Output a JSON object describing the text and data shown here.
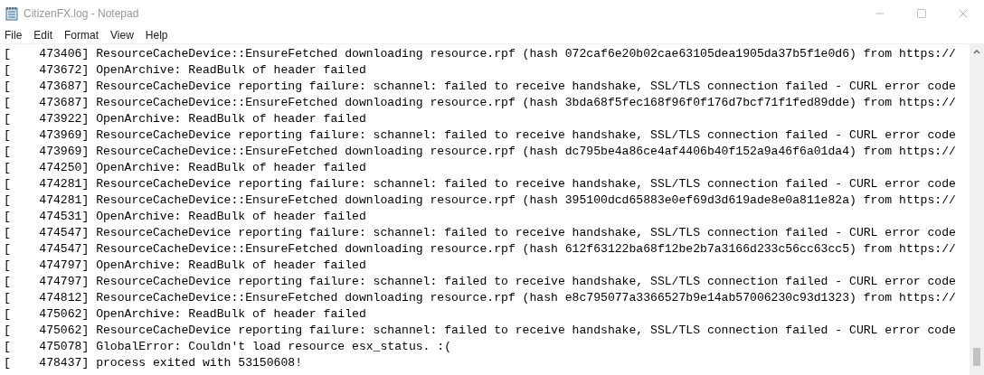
{
  "window": {
    "title": "CitizenFX.log - Notepad"
  },
  "menu": [
    "File",
    "Edit",
    "Format",
    "View",
    "Help"
  ],
  "lines": [
    "[    473406] ResourceCacheDevice::EnsureFetched downloading resource.rpf (hash 072caf6e20b02cae63105dea1905da37b5f1e0d6) from https://",
    "[    473672] OpenArchive: ReadBulk of header failed",
    "[    473687] ResourceCacheDevice reporting failure: schannel: failed to receive handshake, SSL/TLS connection failed - CURL error code",
    "[    473687] ResourceCacheDevice::EnsureFetched downloading resource.rpf (hash 3bda68f5fec168f96f0f176d7bcf71f1fed89dde) from https://",
    "[    473922] OpenArchive: ReadBulk of header failed",
    "[    473969] ResourceCacheDevice reporting failure: schannel: failed to receive handshake, SSL/TLS connection failed - CURL error code",
    "[    473969] ResourceCacheDevice::EnsureFetched downloading resource.rpf (hash dc795be4a86ce4af4406b40f152a9a46f6a01da4) from https://",
    "[    474250] OpenArchive: ReadBulk of header failed",
    "[    474281] ResourceCacheDevice reporting failure: schannel: failed to receive handshake, SSL/TLS connection failed - CURL error code",
    "[    474281] ResourceCacheDevice::EnsureFetched downloading resource.rpf (hash 395100dcd65883e0ef69d3d619ade8e0a811e82a) from https://",
    "[    474531] OpenArchive: ReadBulk of header failed",
    "[    474547] ResourceCacheDevice reporting failure: schannel: failed to receive handshake, SSL/TLS connection failed - CURL error code",
    "[    474547] ResourceCacheDevice::EnsureFetched downloading resource.rpf (hash 612f63122ba68f12be2b7a3166d233c56cc63cc5) from https://",
    "[    474797] OpenArchive: ReadBulk of header failed",
    "[    474797] ResourceCacheDevice reporting failure: schannel: failed to receive handshake, SSL/TLS connection failed - CURL error code",
    "[    474812] ResourceCacheDevice::EnsureFetched downloading resource.rpf (hash e8c795077a3366527b9e14ab57006230c93d1323) from https://",
    "[    475062] OpenArchive: ReadBulk of header failed",
    "[    475062] ResourceCacheDevice reporting failure: schannel: failed to receive handshake, SSL/TLS connection failed - CURL error code",
    "[    475078] GlobalError: Couldn't load resource esx_status. :(",
    "[    478437] process exited with 53150608!"
  ]
}
